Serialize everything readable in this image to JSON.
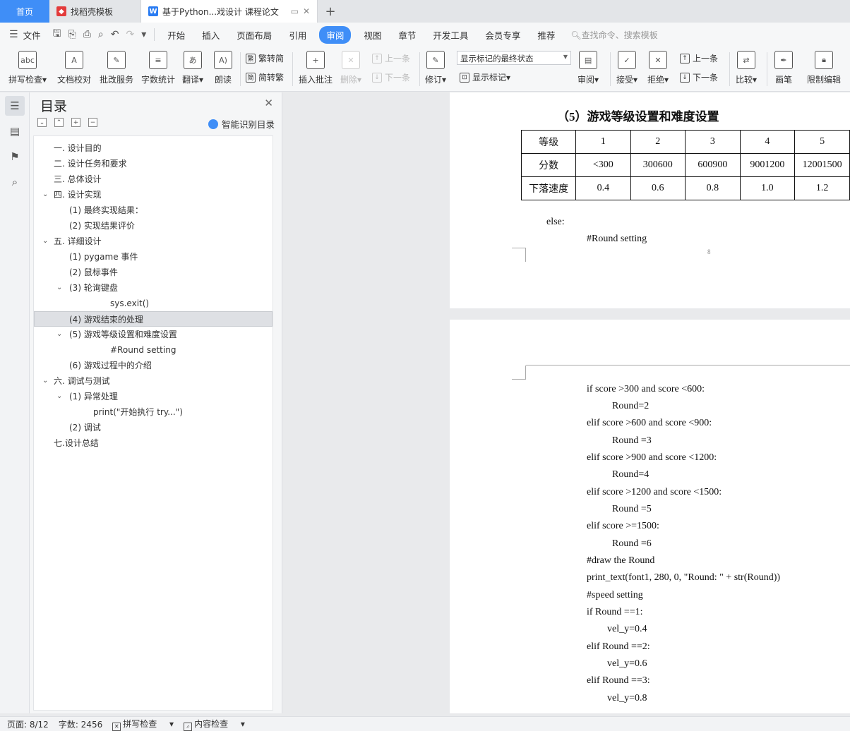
{
  "tabs": {
    "home": "首页",
    "template": "找稻壳模板",
    "document": "基于Python...戏设计 课程论文"
  },
  "menubar": {
    "file": "文件",
    "items": [
      "开始",
      "插入",
      "页面布局",
      "引用",
      "审阅",
      "视图",
      "章节",
      "开发工具",
      "会员专享",
      "推荐"
    ],
    "active": "审阅",
    "search_placeholder": "查找命令、搜索模板"
  },
  "ribbon": {
    "spellcheck": "拼写检查",
    "doc_proof": "文档校对",
    "review_service": "批改服务",
    "word_count": "字数统计",
    "translate": "翻译",
    "read_aloud": "朗读",
    "trad_to_simp": "繁转简",
    "simp_to_trad": "简转繁",
    "insert_comment": "插入批注",
    "delete": "删除",
    "prev_comment": "上一条",
    "next_comment": "下一条",
    "revise": "修订",
    "markup_state": "显示标记的最终状态",
    "show_markup": "显示标记",
    "review": "审阅",
    "accept": "接受",
    "reject": "拒绝",
    "prev_change": "上一条",
    "next_change": "下一条",
    "compare": "比较",
    "pen": "画笔",
    "restrict_edit": "限制编辑"
  },
  "toc": {
    "title": "目录",
    "smart_label": "智能识别目录",
    "items": [
      {
        "text": "一. 设计目的"
      },
      {
        "text": "二. 设计任务和要求"
      },
      {
        "text": "三. 总体设计"
      },
      {
        "text": "四. 设计实现"
      },
      {
        "text": "(1) 最终实现结果："
      },
      {
        "text": "(2) 实现结果评价"
      },
      {
        "text": "五. 详细设计"
      },
      {
        "text": "(1) pygame 事件"
      },
      {
        "text": "(2)  鼠标事件"
      },
      {
        "text": "(3) 轮询键盘"
      },
      {
        "text": "sys.exit()"
      },
      {
        "text": "(4) 游戏结束的处理"
      },
      {
        "text": "(5) 游戏等级设置和难度设置"
      },
      {
        "text": "#Round setting"
      },
      {
        "text": "(6) 游戏过程中的介绍"
      },
      {
        "text": "六. 调试与测试"
      },
      {
        "text": "(1) 异常处理"
      },
      {
        "text": "print(\"开始执行 try...\")"
      },
      {
        "text": "(2) 调试"
      },
      {
        "text": "七.设计总结"
      }
    ]
  },
  "document": {
    "heading": "（5）游戏等级设置和难度设置",
    "table": {
      "rows": [
        [
          "等级",
          "1",
          "2",
          "3",
          "4",
          "5"
        ],
        [
          "分数",
          "<300",
          "300600",
          "600900",
          "9001200",
          "12001500"
        ],
        [
          "下落速度",
          "0.4",
          "0.6",
          "0.8",
          "1.0",
          "1.2"
        ]
      ]
    },
    "page1_lines": [
      "else:",
      "#Round setting"
    ],
    "page_number": "8",
    "page2_lines": [
      "if score >300 and score <600:",
      "Round=2",
      "elif score >600 and score <900:",
      "Round =3",
      "elif score >900 and score <1200:",
      "Round=4",
      "elif score >1200 and score <1500:",
      "Round =5",
      "elif score >=1500:",
      "Round =6",
      "#draw the Round",
      "print_text(font1, 280, 0, \"Round: \" + str(Round))",
      "#speed setting",
      "if Round ==1:",
      "vel_y=0.4",
      "elif Round ==2:",
      "vel_y=0.6",
      "elif Round ==3:",
      "vel_y=0.8"
    ]
  },
  "status": {
    "page": "页面: 8/12",
    "words": "字数: 2456",
    "spellcheck": "拼写检查",
    "content_check": "内容检查"
  }
}
